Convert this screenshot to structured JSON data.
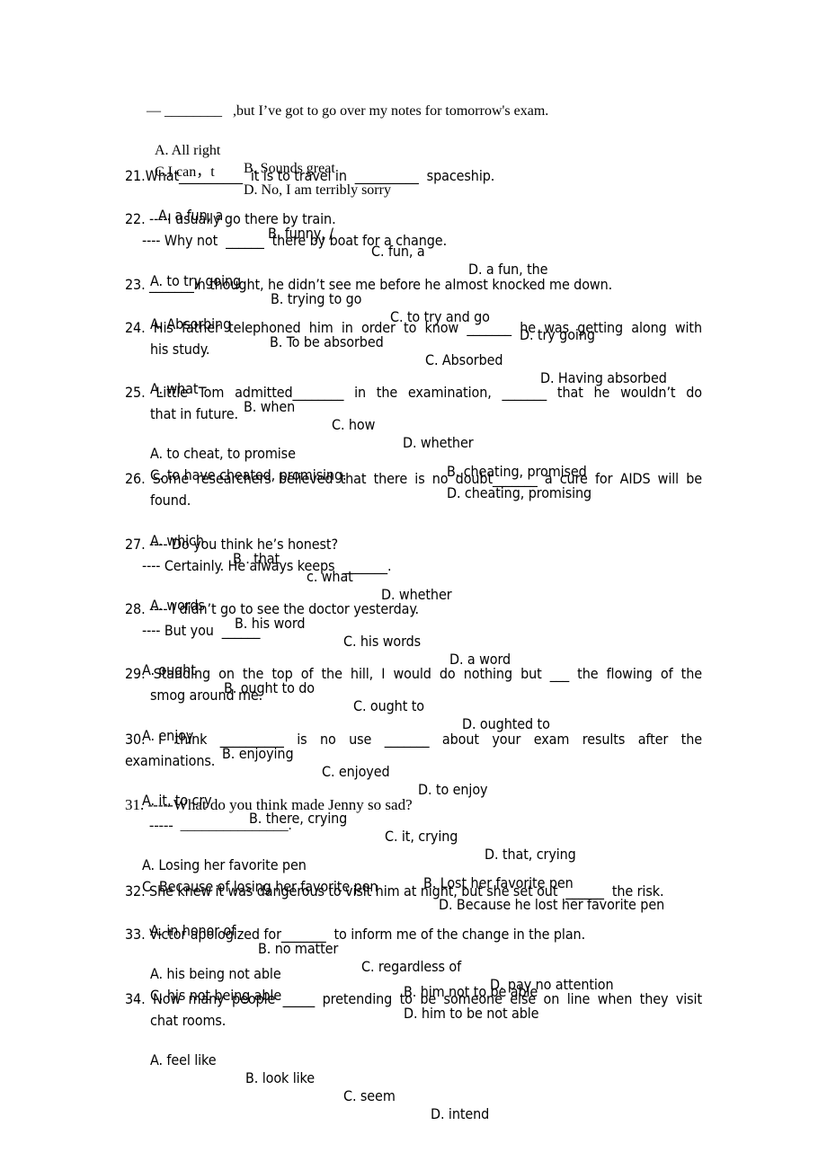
{
  "document": {
    "q20": {
      "response": "— ________   ,but I’ve got to go over my notes for tomorrow's exam.",
      "options": [
        "A. All right",
        "B. Sounds great",
        "C.I can，t",
        "D. No, I am terribly sorry"
      ]
    },
    "q21": {
      "stem": "21.What__________  it is to travel in  __________  spaceship.",
      "options": [
        "A. a fun, a",
        "B. funny, /",
        "C. fun, a",
        "D. a fun, the"
      ]
    },
    "q22": {
      "stem": "22. ----I usually go there by train.",
      "response": "---- Why not  ______  there by boat for a change.",
      "options": [
        "A. to try going",
        "B. trying to go",
        "C. to try and go",
        "D. try going"
      ]
    },
    "q23": {
      "stem": "23. _______in thought, he didn’t see me before he almost knocked me down.",
      "options": [
        "A. Absorbing",
        "B. To be absorbed",
        "C. Absorbed",
        "D. Having absorbed"
      ]
    },
    "q24": {
      "stem": "24. His father telephoned him in order to know  _______  he was getting along with",
      "stem_cont": "his study.",
      "options": [
        "A. what",
        "B. when",
        "C. how",
        "D. whether"
      ]
    },
    "q25": {
      "stem": "25. Little Tom admitted________  in the examination,  _______  that he wouldn’t do",
      "stem_cont": "that in future.",
      "options": [
        "A. to cheat, to promise",
        "B. cheating, promised",
        "C. to have cheated, promising.",
        "D. cheating, promising"
      ]
    },
    "q26": {
      "stem": "26. Some researchers believed that there is no doubt_______  a cure for AIDS will be",
      "stem_cont": "found.",
      "options": [
        "A. which",
        "B . that",
        "c. what",
        "D. whether"
      ]
    },
    "q27": {
      "stem": "27. ---- Do you think he’s honest?",
      "response": "---- Certainly. He always keeps  _______.",
      "options": [
        "A. words",
        "B. his word",
        "C. his words",
        "D. a word"
      ]
    },
    "q28": {
      "stem": "28. ---- I didn’t go to see the doctor yesterday.",
      "response": "---- But you  ______",
      "options": [
        "A. ought",
        "B. ought to do",
        "C. ought to",
        "D. oughted to"
      ]
    },
    "q29": {
      "stem": "29. Standing on the top of the hill, I would do nothing but  ___  the flowing of the",
      "stem_cont": "smog around me.",
      "options": [
        "A. enjoy",
        "B. enjoying",
        "C. enjoyed",
        "D. to enjoy"
      ]
    },
    "q30": {
      "stem": "30. I think  __________  is no use  _______  about your exam results after the",
      "stem_cont": "examinations.",
      "options": [
        "A. it, to cry",
        "B. there, crying",
        "C. it, crying",
        "D. that, crying"
      ]
    },
    "q31": {
      "stem": "31. -----What do you think made Jenny so sad?",
      "response": "-----  _______________.",
      "options": [
        "A. Losing her favorite pen",
        "B. Lost her favorite pen",
        "C. Because of losing her favorite pen",
        "D. Because he lost her favorite pen"
      ]
    },
    "q32": {
      "stem": "32. She knew it was dangerous to visit him at night, but she set out  ______  the risk.",
      "options": [
        "A. in honor of",
        "B. no matter",
        "C. regardless of",
        "D. pay no attention"
      ]
    },
    "q33": {
      "stem": "33. Victor apologized for_______  to inform me of the change in the plan.",
      "options": [
        "A. his being not able",
        "B. him not to be able",
        "C. his not being able",
        "D. him to be not able"
      ]
    },
    "q34": {
      "stem": "34. Now many people  _____  pretending to be someone else on line when they visit",
      "stem_cont": "chat rooms.",
      "options": [
        "A. feel like",
        "B. look like",
        "C. seem",
        "D. intend"
      ]
    }
  }
}
